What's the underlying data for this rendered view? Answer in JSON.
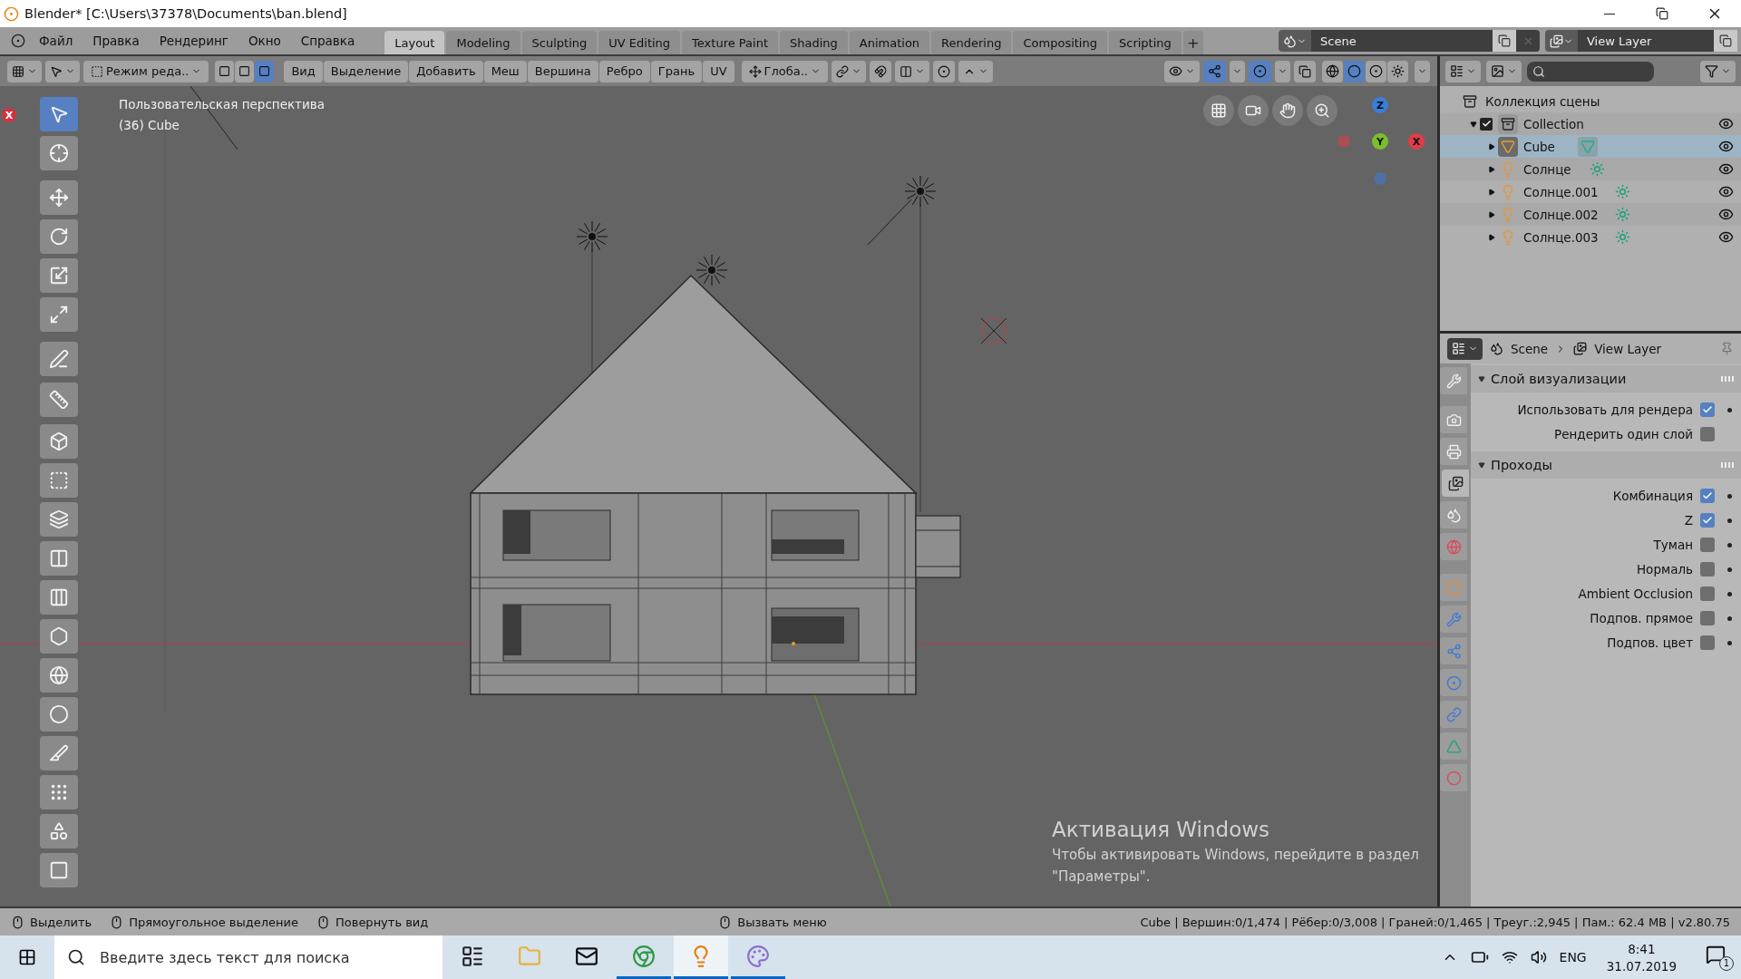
{
  "window": {
    "title": "Blender* [C:\\Users\\37378\\Documents\\ban.blend]"
  },
  "menu": [
    "Файл",
    "Правка",
    "Рендеринг",
    "Окно",
    "Справка"
  ],
  "workspace_tabs": [
    {
      "label": "Layout",
      "selected": true
    },
    {
      "label": "Modeling",
      "selected": false
    },
    {
      "label": "Sculpting",
      "selected": false
    },
    {
      "label": "UV Editing",
      "selected": false
    },
    {
      "label": "Texture Paint",
      "selected": false
    },
    {
      "label": "Shading",
      "selected": false
    },
    {
      "label": "Animation",
      "selected": false
    },
    {
      "label": "Rendering",
      "selected": false
    },
    {
      "label": "Compositing",
      "selected": false
    },
    {
      "label": "Scripting",
      "selected": false
    }
  ],
  "add_tab": "+",
  "scene": {
    "name": "Scene"
  },
  "view_layer": {
    "name": "View Layer"
  },
  "viewport_header": {
    "mode": "Режим реда..",
    "select_modes": [
      {
        "selected": false
      },
      {
        "selected": false
      },
      {
        "selected": true
      }
    ],
    "menus": [
      "Вид",
      "Выделение",
      "Добавить",
      "Меш",
      "Вершина",
      "Ребро",
      "Грань",
      "UV"
    ],
    "orientation": "Глоба..",
    "shading_modes": [
      {
        "selected": false
      },
      {
        "selected": true
      },
      {
        "selected": false
      },
      {
        "selected": false
      }
    ]
  },
  "viewport": {
    "view_name": "Пользовательская перспектива",
    "object_info": "(36) Cube",
    "edge_axis_label": "X",
    "gizmo": {
      "z": "Z",
      "y": "Y",
      "x": "X"
    }
  },
  "toolbar": [
    {
      "selected": true
    },
    {
      "selected": false
    },
    {
      "selected": false
    },
    {
      "selected": false
    },
    {
      "selected": false
    },
    {
      "selected": false
    },
    {
      "selected": false
    },
    {
      "selected": false
    },
    {
      "selected": false
    },
    {
      "selected": false
    },
    {
      "selected": false
    },
    {
      "selected": false
    },
    {
      "selected": false
    },
    {
      "selected": false
    },
    {
      "selected": false
    },
    {
      "selected": false
    },
    {
      "selected": false
    },
    {
      "selected": false
    },
    {
      "selected": false
    },
    {
      "selected": false
    }
  ],
  "outliner": {
    "root": "Коллекция сцены",
    "items": [
      {
        "name": "Collection",
        "checked": true,
        "expanded": true,
        "children": [
          {
            "name": "Cube",
            "kind": "mesh",
            "selected": true
          },
          {
            "name": "Солнце",
            "kind": "light",
            "selected": false
          },
          {
            "name": "Солнце.001",
            "kind": "light",
            "selected": false
          },
          {
            "name": "Солнце.002",
            "kind": "light",
            "selected": false
          },
          {
            "name": "Солнце.003",
            "kind": "light",
            "selected": false
          }
        ]
      }
    ]
  },
  "properties": {
    "breadcrumb": [
      "Scene",
      "View Layer"
    ],
    "tabs": [
      {
        "selected": false
      },
      {
        "selected": false
      },
      {
        "selected": false
      },
      {
        "selected": true
      },
      {
        "selected": false
      },
      {
        "selected": false
      },
      {
        "selected": false
      },
      {
        "selected": false
      },
      {
        "selected": false
      },
      {
        "selected": false
      },
      {
        "selected": false
      },
      {
        "selected": false
      },
      {
        "selected": false
      }
    ],
    "panels": [
      {
        "title": "Слой визуализации",
        "expanded": true,
        "rows": [
          {
            "label": "Использовать для рендера",
            "checked": true,
            "animatable": true
          },
          {
            "label": "Рендерить один слой",
            "checked": false,
            "animatable": false
          }
        ]
      },
      {
        "title": "Проходы",
        "expanded": true,
        "rows": [
          {
            "label": "Комбинация",
            "checked": true,
            "animatable": true
          },
          {
            "label": "Z",
            "checked": true,
            "animatable": true
          },
          {
            "label": "Туман",
            "checked": false,
            "animatable": true
          },
          {
            "label": "Нормаль",
            "checked": false,
            "animatable": true
          },
          {
            "label": "Ambient Occlusion",
            "checked": false,
            "animatable": true
          },
          {
            "label": "Подпов. прямое",
            "checked": false,
            "animatable": true
          },
          {
            "label": "Подпов. цвет",
            "checked": false,
            "animatable": true
          }
        ]
      }
    ]
  },
  "status_bar": {
    "hints": [
      "Выделить",
      "Прямоугольное выделение",
      "Повернуть вид",
      "Вызвать меню"
    ],
    "stats": "Cube | Вершин:0/1,474 | Рёбер:0/3,008 | Граней:0/1,465 | Треуг.:2,945 | Пам.: 62.4 MB | v2.80.75"
  },
  "activation": {
    "title": "Активация Windows",
    "text": "Чтобы активировать Windows, перейдите в раздел",
    "link": "\"Параметры\"."
  },
  "taskbar": {
    "search_placeholder": "Введите здесь текст для поиска",
    "apps": [
      {
        "running": false,
        "selected": false
      },
      {
        "running": false,
        "selected": false
      },
      {
        "running": false,
        "selected": false
      },
      {
        "running": true,
        "selected": false
      },
      {
        "running": true,
        "selected": true
      },
      {
        "running": true,
        "selected": false
      }
    ],
    "language": "ENG",
    "time": "8:41",
    "date": "31.07.2019",
    "notifications": "1"
  }
}
